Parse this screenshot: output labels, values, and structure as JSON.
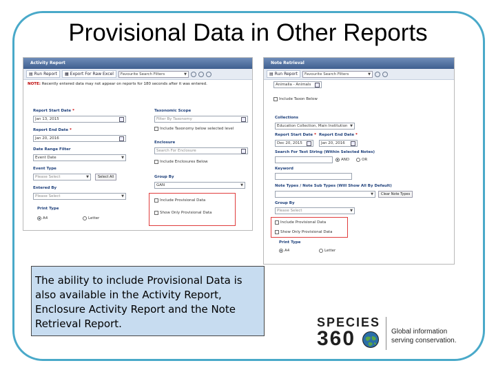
{
  "slide": {
    "title": "Provisional Data in Other Reports",
    "caption": "The ability to include Provisional Data is also available in the Activity Report, Enclosure Activity Report and the Note Retrieval Report."
  },
  "activity_report": {
    "window_title": "Activity Report",
    "run_report": "Run Report",
    "export": "Export For Raw Excel",
    "favourite_filters": "Favourite Search Filters",
    "note_prefix": "NOTE:",
    "note_text": "Recently entered data may not appear on reports for 180 seconds after it was entered.",
    "start_date_label": "Report Start Date",
    "start_date_value": "Jan 13, 2015",
    "end_date_label": "Report End Date",
    "end_date_value": "Jan 20, 2016",
    "date_range_label": "Date Range Filter",
    "date_range_value": "Event Date",
    "event_type_label": "Event Type",
    "event_type_value": "Please Select",
    "select_all": "Select All",
    "entered_by_label": "Entered By",
    "entered_by_value": "Please Select",
    "print_type_label": "Print Type",
    "print_a4": "A4",
    "print_letter": "Letter",
    "taxonomic_scope_label": "Taxonomic Scope",
    "taxonomic_scope_value": "Filter By Taxonomy",
    "include_taxonomy_below": "Include Taxonomy below selected level",
    "enclosure_label": "Enclosure",
    "enclosure_value": "Search For Enclosure",
    "include_enclosures_below": "Include Enclosures Below",
    "group_by_label": "Group By",
    "group_by_value": "GAN",
    "include_provisional": "Include Provisional Data",
    "show_only_provisional": "Show Only Provisional Data"
  },
  "note_retrieval": {
    "window_title": "Note Retrieval",
    "run_report": "Run Report",
    "favourite_filters": "Favourite Search Filters",
    "scope_value": "Animalia - Animals",
    "include_taxon_below": "Include Taxon Below",
    "collections_label": "Collections",
    "collections_value": "Education Collection, Main Institution",
    "start_date_label": "Report Start Date",
    "start_date_value": "Dec 20, 2015",
    "end_date_label": "Report End Date",
    "end_date_value": "Jan 20, 2016",
    "search_text_label": "Search For Text String (Within Selected Notes)",
    "and_label": "AND",
    "or_label": "OR",
    "keyword_label": "Keyword",
    "note_types_label": "Note Types / Note Sub Types (Will Show All By Default)",
    "clear_note_types": "Clear Note Types",
    "group_by_label": "Group By",
    "group_by_value": "Please Select",
    "include_provisional": "Include Provisional Data",
    "show_only_provisional": "Show Only Provisional Data",
    "print_type_label": "Print Type",
    "print_a4": "A4",
    "print_letter": "Letter"
  },
  "logo": {
    "species": "SPECIES",
    "number": "360",
    "tagline1": "Global information",
    "tagline2": "serving conservation."
  }
}
